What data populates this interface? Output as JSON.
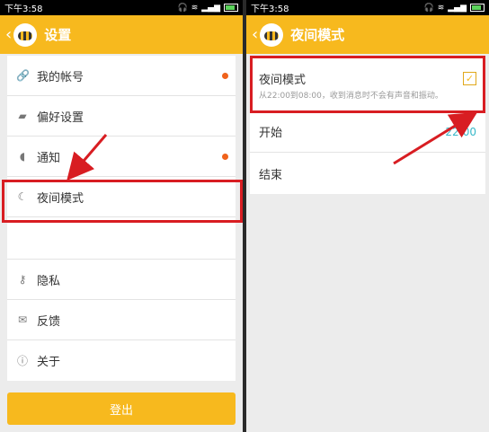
{
  "left": {
    "status": {
      "time": "下午3:58"
    },
    "header": {
      "back": "‹",
      "title": "设置"
    },
    "items": [
      {
        "label": "我的帐号",
        "icon": "link-icon"
      },
      {
        "label": "偏好设置",
        "icon": "preferences-icon"
      },
      {
        "label": "通知",
        "icon": "bell-icon"
      },
      {
        "label": "夜间模式",
        "icon": "moon-icon"
      },
      {
        "label": "",
        "icon": ""
      },
      {
        "label": "隐私",
        "icon": "key-icon"
      },
      {
        "label": "反馈",
        "icon": "mail-icon"
      },
      {
        "label": "关于",
        "icon": "info-icon"
      }
    ],
    "logout": "登出"
  },
  "right": {
    "status": {
      "time": "下午3:58"
    },
    "header": {
      "back": "‹",
      "title": "夜间模式"
    },
    "night_mode": {
      "label": "夜间模式",
      "description": "从22:00到08:00，收到消息时不会有声音和振动。",
      "checked": true
    },
    "start": {
      "label": "开始",
      "value": "22:00"
    },
    "end": {
      "label": "结束"
    }
  },
  "colors": {
    "accent": "#f7b91e",
    "highlight": "#d81d22",
    "notification_dot": "#f0621b",
    "time_value": "#38b8c8"
  }
}
